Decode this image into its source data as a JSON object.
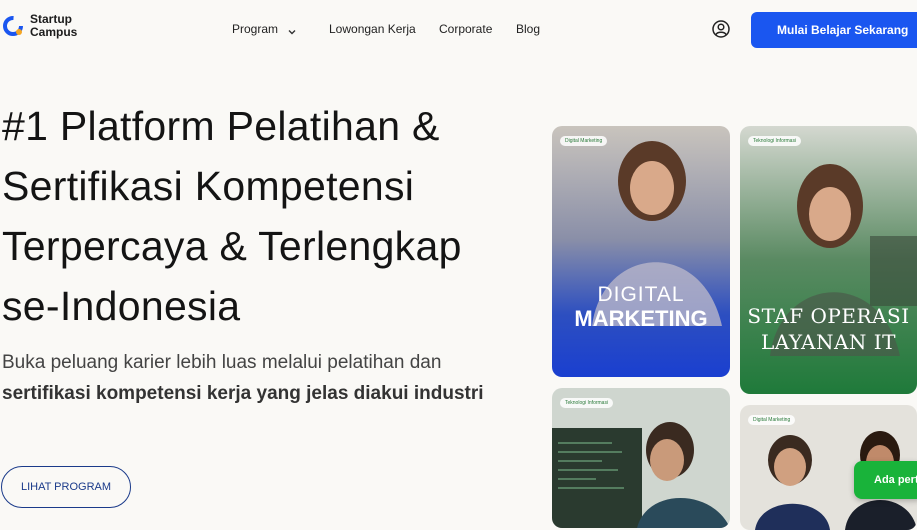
{
  "brand": {
    "line1": "Startup",
    "line2": "Campus",
    "icon": "logo-icon"
  },
  "nav": {
    "program": "Program",
    "jobs": "Lowongan Kerja",
    "corporate": "Corporate",
    "blog": "Blog"
  },
  "header": {
    "cta": "Mulai Belajar Sekarang",
    "user_icon": "user-icon"
  },
  "hero": {
    "title_lines": [
      "#1 Platform Pelatihan &",
      "Sertifikasi Kompetensi",
      "Terpercaya & Terlengkap",
      "se-Indonesia"
    ],
    "subtitle_plain": "Buka peluang karier lebih luas melalui pelatihan dan ",
    "subtitle_bold": "sertifikasi kompetensi kerja yang jelas diakui industri",
    "button": "LIHAT PROGRAM"
  },
  "cards": [
    {
      "line1": "DIGITAL",
      "line2": "MARKETING",
      "tag": "Digital Marketing",
      "color": "#1e4bd6"
    },
    {
      "line1": "STAF OPERASI",
      "line2": "LAYANAN IT",
      "tag": "Teknologi Informasi",
      "color": "#1f7a3a"
    },
    {
      "tag": "Teknologi Informasi",
      "color": "#2a5a3a"
    },
    {
      "tag": "Digital Marketing",
      "color": "#2a3f6a"
    }
  ],
  "help": {
    "label": "Ada pert"
  },
  "colors": {
    "primary": "#1a56f0",
    "outline": "#1a3a8a",
    "help": "#19b33a",
    "background": "#faf9f6"
  }
}
